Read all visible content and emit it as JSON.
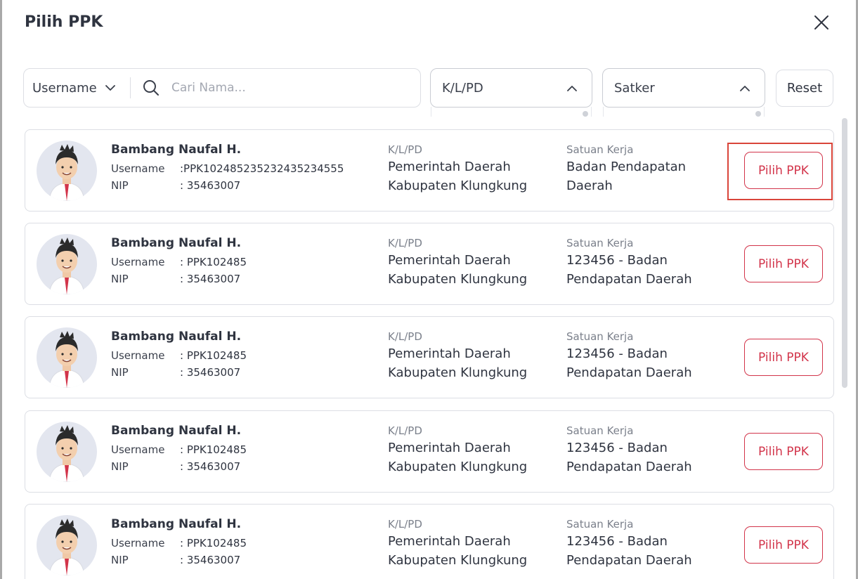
{
  "dialog": {
    "title": "Pilih PPK"
  },
  "filters": {
    "search_type": "Username",
    "search_placeholder": "Cari Nama...",
    "klpd_label": "K/L/PD",
    "satker_label": "Satker",
    "reset_label": "Reset"
  },
  "labels": {
    "username": "Username",
    "nip": "NIP",
    "klpd": "K/L/PD",
    "satker": "Satuan Kerja",
    "pilih": "Pilih PPK"
  },
  "list": [
    {
      "name": "Bambang Naufal H.",
      "username": ":PPK10248523523243523455​5",
      "nip": ": 35463007",
      "klpd_line1": "Pemerintah Daerah",
      "klpd_line2": "Kabupaten Klungkung",
      "satker_line1": "Badan Pendapatan",
      "satker_line2": "Daerah"
    },
    {
      "name": "Bambang Naufal H.",
      "username": ": PPK102485",
      "nip": ": 35463007",
      "klpd_line1": "Pemerintah Daerah",
      "klpd_line2": "Kabupaten Klungkung",
      "satker_line1": "123456 - Badan",
      "satker_line2": "Pendapatan Daerah"
    },
    {
      "name": "Bambang Naufal H.",
      "username": ": PPK102485",
      "nip": ": 35463007",
      "klpd_line1": "Pemerintah Daerah",
      "klpd_line2": "Kabupaten Klungkung",
      "satker_line1": "123456 - Badan",
      "satker_line2": "Pendapatan Daerah"
    },
    {
      "name": "Bambang Naufal H.",
      "username": ": PPK102485",
      "nip": ": 35463007",
      "klpd_line1": "Pemerintah Daerah",
      "klpd_line2": "Kabupaten Klungkung",
      "satker_line1": "123456 - Badan",
      "satker_line2": "Pendapatan Daerah"
    },
    {
      "name": "Bambang Naufal H.",
      "username": ": PPK102485",
      "nip": ": 35463007",
      "klpd_line1": "Pemerintah Daerah",
      "klpd_line2": "Kabupaten Klungkung",
      "satker_line1": "123456 - Badan",
      "satker_line2": "Pendapatan Daerah"
    }
  ],
  "colors": {
    "accent": "#d2344a",
    "highlight": "#d9453a",
    "border": "#dcdee4",
    "text": "#2f3440"
  },
  "icons": {
    "close": "close-icon",
    "search": "search-icon",
    "chevron": "chevron-icon",
    "avatar": "avatar-icon"
  }
}
